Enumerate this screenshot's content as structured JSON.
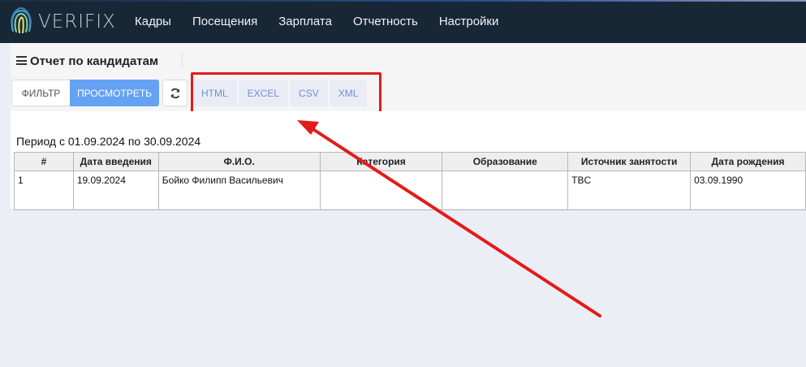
{
  "header": {
    "brand": "VERIFIX",
    "nav": [
      "Кадры",
      "Посещения",
      "Зарплата",
      "Отчетность",
      "Настройки"
    ]
  },
  "page": {
    "title": "Отчет по кандидатам",
    "filter_label": "ФИЛЬТР",
    "view_label": "ПРОСМОТРЕТЬ",
    "exports": [
      "HTML",
      "EXCEL",
      "CSV",
      "XML"
    ]
  },
  "report": {
    "period": "Период с 01.09.2024 по 30.09.2024",
    "columns": [
      "#",
      "Дата введения",
      "Ф.И.О.",
      "Категория",
      "Образование",
      "Источник занятости",
      "Дата рождения"
    ],
    "rows": [
      [
        "1",
        "19.09.2024",
        "Бойко Филипп Васильевич",
        "",
        "",
        "TBC",
        "03.09.1990"
      ]
    ]
  },
  "colors": {
    "topbar": "#172736",
    "accent": "#65a2f4",
    "highlight": "#e41b1b"
  }
}
